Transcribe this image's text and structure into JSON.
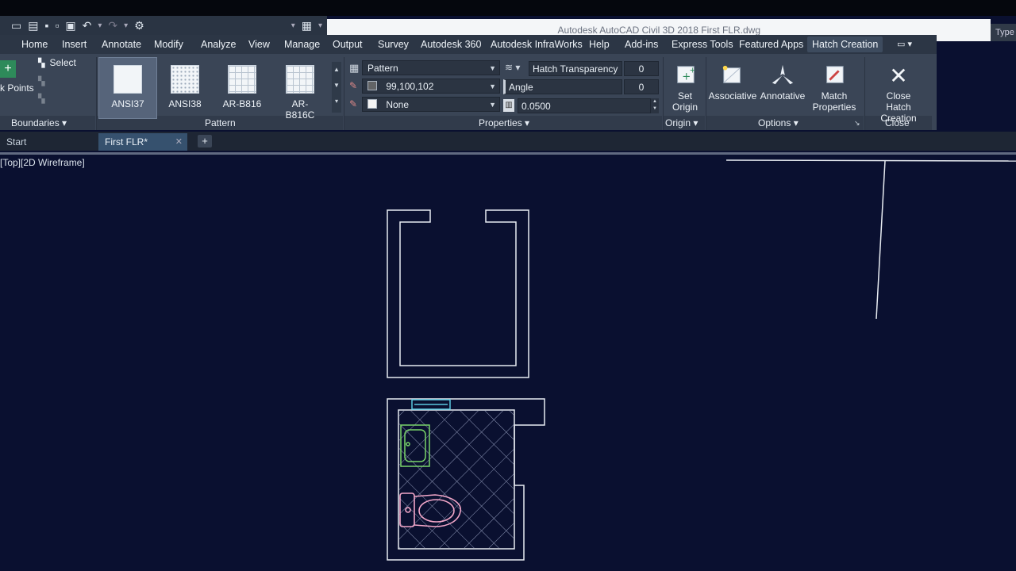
{
  "window": {
    "title": "Autodesk AutoCAD Civil 3D 2018    First FLR.dwg",
    "search_hint": "Type"
  },
  "menu_tabs": [
    {
      "label": "Home",
      "active": false
    },
    {
      "label": "Insert",
      "active": false
    },
    {
      "label": "Annotate",
      "active": false
    },
    {
      "label": "Modify",
      "active": false
    },
    {
      "label": "Analyze",
      "active": false
    },
    {
      "label": "View",
      "active": false
    },
    {
      "label": "Manage",
      "active": false
    },
    {
      "label": "Output",
      "active": false
    },
    {
      "label": "Survey",
      "active": false
    },
    {
      "label": "Autodesk 360",
      "active": false
    },
    {
      "label": "Autodesk InfraWorks",
      "active": false
    },
    {
      "label": "Help",
      "active": false
    },
    {
      "label": "Add-ins",
      "active": false
    },
    {
      "label": "Express Tools",
      "active": false
    },
    {
      "label": "Featured Apps",
      "active": false
    },
    {
      "label": "Hatch Creation",
      "active": true
    }
  ],
  "ribbon": {
    "boundaries": {
      "pick_points_label": "k Points",
      "select_label": "Select",
      "panel_label": "Boundaries"
    },
    "pattern": {
      "panel_label": "Pattern",
      "items": [
        "ANSI37",
        "ANSI38",
        "AR-B816",
        "AR-B816C"
      ],
      "selected": "ANSI37"
    },
    "properties": {
      "panel_label": "Properties",
      "hatch_type": "Pattern",
      "color": "99,100,102",
      "background": "None",
      "transparency_label": "Hatch Transparency",
      "transparency_value": "0",
      "angle_label": "Angle",
      "angle_value": "0",
      "scale_value": "0.0500"
    },
    "origin": {
      "set_origin_label": "Set\nOrigin",
      "panel_label": "Origin"
    },
    "options": {
      "associative_label": "Associative",
      "annotative_label": "Annotative",
      "match_properties_label": "Match\nProperties",
      "panel_label": "Options"
    },
    "close": {
      "close_label": "Close\nHatch Creation",
      "panel_label": "Close"
    }
  },
  "file_tabs": [
    {
      "label": "Start",
      "active": false
    },
    {
      "label": "First FLR*",
      "active": true
    }
  ],
  "viewport": {
    "label": "[Top][2D Wireframe]"
  },
  "colors": {
    "model_background": "#0a1030",
    "ribbon": "#3a4556",
    "wall_lines": "#e8ecf2",
    "sink": "#7ad66a",
    "toilet": "#f2a6c8",
    "window": "#5ac8e0"
  }
}
